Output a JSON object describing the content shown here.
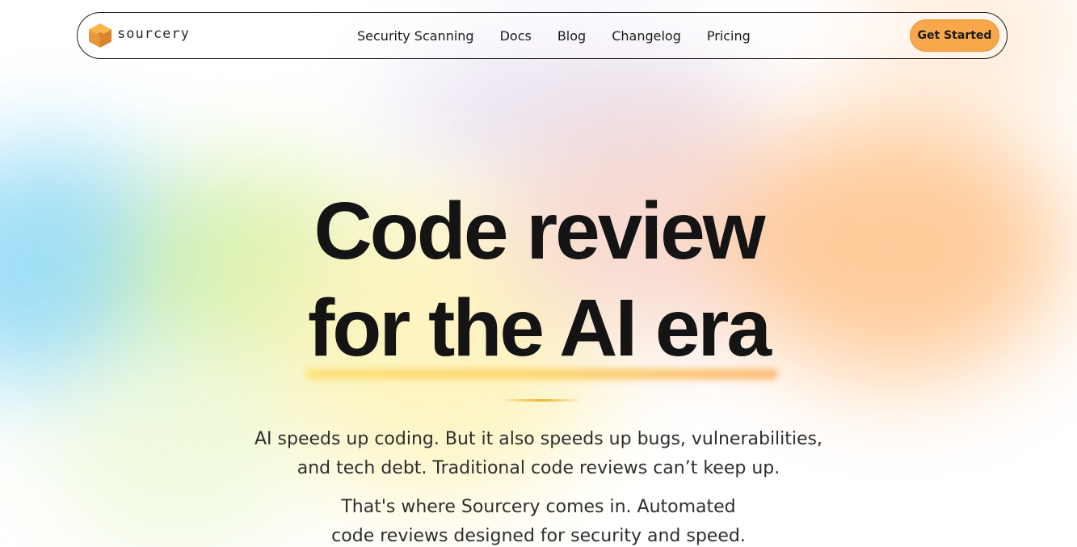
{
  "brand": {
    "name": "sourcery",
    "logo_icon": "sourcery-cube-logo",
    "accent_color": "#f8a74a"
  },
  "nav": {
    "links": [
      {
        "label": "Security Scanning"
      },
      {
        "label": "Docs"
      },
      {
        "label": "Blog"
      },
      {
        "label": "Changelog"
      },
      {
        "label": "Pricing"
      }
    ],
    "cta_label": "Get Started"
  },
  "hero": {
    "headline_line1": "Code review",
    "headline_line2": "for the AI era",
    "paragraph1_line1": "AI speeds up coding. But it also speeds up bugs, vulnerabilities,",
    "paragraph1_line2": "and tech debt. Traditional code reviews can’t keep up.",
    "paragraph2_line1": "That's where Sourcery comes in. Automated",
    "paragraph2_line2": "code reviews designed for security and speed."
  }
}
